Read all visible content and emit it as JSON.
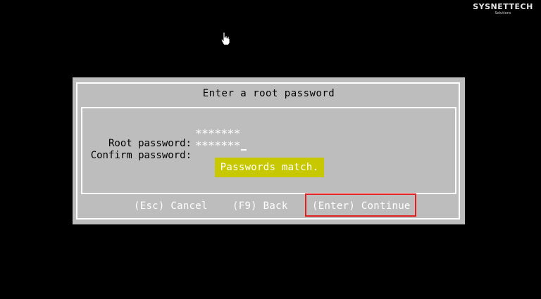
{
  "watermark": {
    "brand": "SYSNETTECH",
    "sub": "Solutions"
  },
  "dialog": {
    "title": "Enter a root password",
    "fields": [
      {
        "label": "Root password:",
        "value": "*******"
      },
      {
        "label": "Confirm password:",
        "value": "*******"
      }
    ],
    "status": "Passwords match.",
    "keys": {
      "cancel": "(Esc) Cancel",
      "back": "(F9) Back",
      "continue": "(Enter) Continue"
    }
  },
  "colors": {
    "screen_bg": "#000000",
    "dialog_bg": "#bdbdbd",
    "frame": "#ffffff",
    "status_bg": "#c8c800",
    "highlight": "#e02020"
  },
  "icons": {
    "pointer": "hand-pointer-icon"
  }
}
